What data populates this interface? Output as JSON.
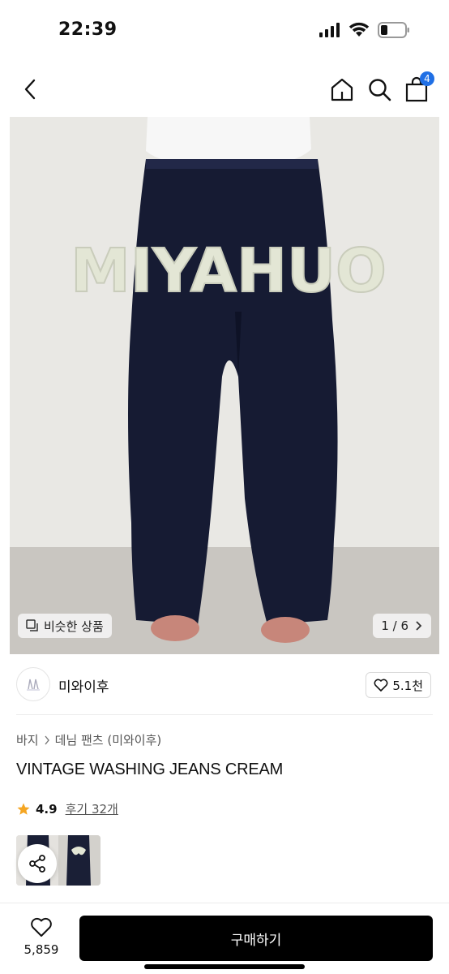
{
  "status_bar": {
    "time": "22:39"
  },
  "nav": {
    "cart_count": "4"
  },
  "hero": {
    "similar_label": "비슷한 상품",
    "page_indicator": "1 / 6",
    "print_text": "MIYAHUO"
  },
  "brand": {
    "name": "미와이후",
    "likes": "5.1천"
  },
  "breadcrumb": {
    "category": "바지",
    "subcategory": "데님 팬츠 (미와이후)"
  },
  "product": {
    "title": "VINTAGE WASHING JEANS CREAM",
    "rating": "4.9",
    "reviews": "후기 32개"
  },
  "bottom": {
    "wish_count": "5,859",
    "buy_label": "구매하기"
  },
  "colors": {
    "accent_badge": "#1f6fe5",
    "star": "#f5a623",
    "buy_button": "#000000"
  }
}
